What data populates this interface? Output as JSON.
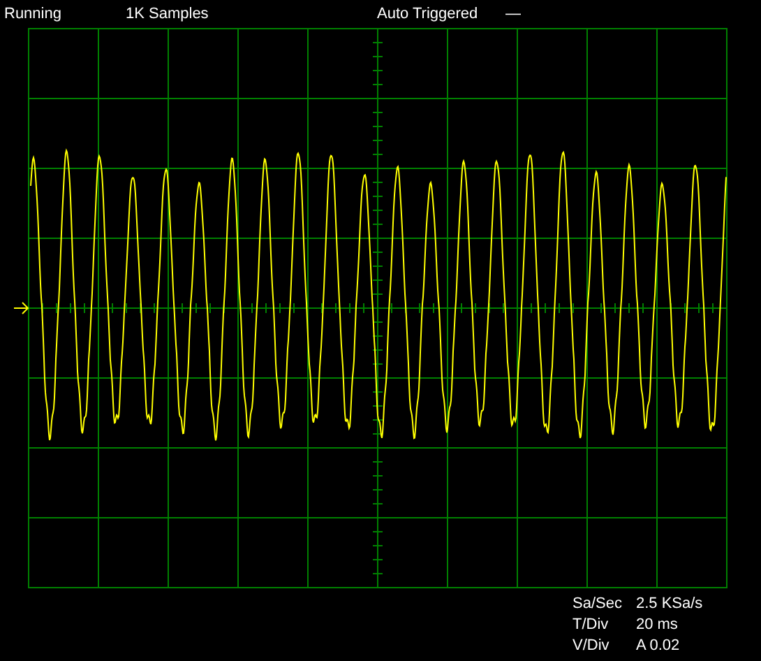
{
  "status_bar": {
    "run_state": "Running",
    "samples": "1K Samples",
    "trigger": "Auto Triggered",
    "trigger_indicator": "—"
  },
  "readouts": [
    {
      "label": "Sa/Sec",
      "value": "2.5 KSa/s"
    },
    {
      "label": "T/Div",
      "value": "20 ms"
    },
    {
      "label": "V/Div",
      "value": "A 0.02"
    }
  ]
}
